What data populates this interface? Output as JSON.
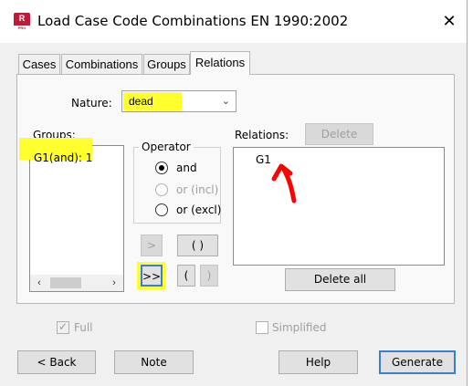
{
  "window": {
    "title": "Load Case Code Combinations EN 1990:2002",
    "icon_letter": "R",
    "icon_sub": "PRO"
  },
  "tabs": [
    {
      "label": "Cases"
    },
    {
      "label": "Combinations"
    },
    {
      "label": "Groups"
    },
    {
      "label": "Relations",
      "active": true
    }
  ],
  "nature": {
    "label": "Nature:",
    "selected": "dead"
  },
  "groups": {
    "label": "Groups:",
    "items": [
      "G1(and): 1"
    ]
  },
  "operator": {
    "label": "Operator",
    "options": [
      {
        "label": "and",
        "checked": true,
        "enabled": true
      },
      {
        "label": "or (incl)",
        "checked": false,
        "enabled": false
      },
      {
        "label": "or (excl)",
        "checked": false,
        "enabled": true
      }
    ]
  },
  "transfer": {
    "add_one": ">",
    "add_all": ">>",
    "parens": "( )",
    "open_paren": "(",
    "close_paren": ")"
  },
  "relations": {
    "label": "Relations:",
    "delete_label": "Delete",
    "items": [
      "G1"
    ],
    "delete_all_label": "Delete all"
  },
  "options": {
    "full_label": "Full",
    "full_checked": true,
    "simplified_label": "Simplified",
    "simplified_checked": false
  },
  "footer": {
    "back_label": "< Back",
    "note_label": "Note",
    "help_label": "Help",
    "generate_label": "Generate"
  },
  "colors": {
    "highlight": "#ffff2e",
    "annotation_arrow": "#ff0000",
    "icon_brand": "#c2183a",
    "default_button_border": "#3c7fd1"
  },
  "annotations": {
    "arrow": "red-hand-drawn-arrow"
  }
}
